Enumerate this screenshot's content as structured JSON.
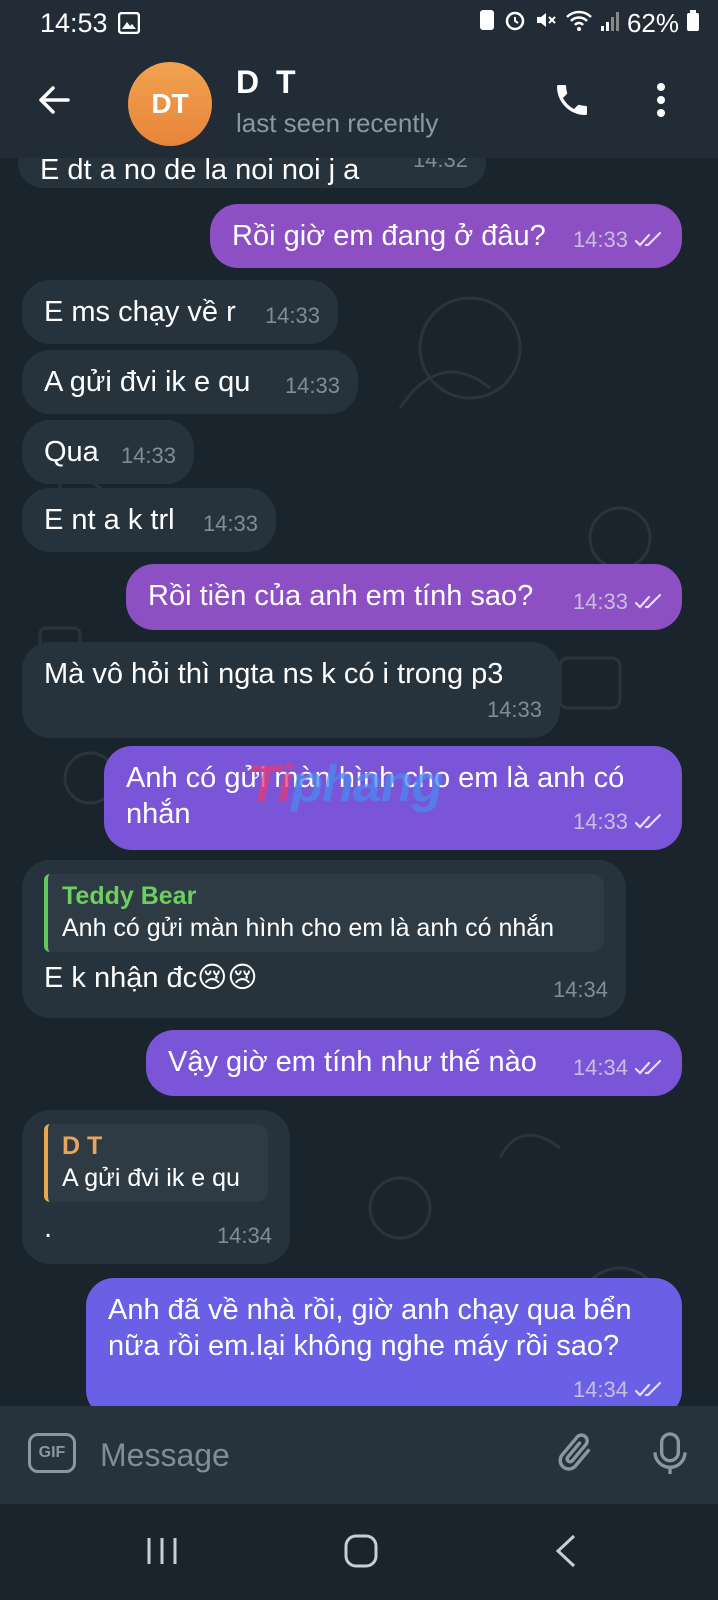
{
  "status_bar": {
    "time": "14:53",
    "battery": "62%"
  },
  "header": {
    "avatar_initials": "DT",
    "name": "D T",
    "status": "last seen recently"
  },
  "messages": [
    {
      "dir": "in",
      "text": "E dt a no de la noi noi j a",
      "time": "14:32"
    },
    {
      "dir": "out",
      "text": "Rồi giờ em đang ở đâu?",
      "time": "14:33"
    },
    {
      "dir": "in",
      "text": "E ms chạy về r",
      "time": "14:33"
    },
    {
      "dir": "in",
      "text": "A gửi đvi ik e qu",
      "time": "14:33"
    },
    {
      "dir": "in",
      "text": "Qua",
      "time": "14:33"
    },
    {
      "dir": "in",
      "text": "E nt a k trl",
      "time": "14:33"
    },
    {
      "dir": "out",
      "text": "Rồi tiền của anh em tính sao?",
      "time": "14:33"
    },
    {
      "dir": "in",
      "text": "Mà vô hỏi thì ngta ns k có i trong p3",
      "time": "14:33"
    },
    {
      "dir": "out",
      "text": "Anh có gửi màn hình cho em là anh có nhắn",
      "time": "14:33"
    },
    {
      "dir": "in",
      "reply_name": "Teddy Bear",
      "reply_text": "Anh có gửi màn hình cho em là anh có nhắn",
      "text": "E k nhận đc😢😢",
      "time": "14:34"
    },
    {
      "dir": "out",
      "text": "Vậy giờ em tính như thế nào",
      "time": "14:34"
    },
    {
      "dir": "in",
      "reply_name": "D T",
      "reply_text": "A gửi đvi ik e qu",
      "text": ".",
      "time": "14:34"
    },
    {
      "dir": "out",
      "text": "Anh đã về nhà rồi, giờ anh chạy qua bển nữa rồi em.lại không nghe máy rồi sao?",
      "time": "14:34"
    }
  ],
  "watermark": {
    "part1": "Ti",
    "part2": "phang"
  },
  "input": {
    "gif_label": "GIF",
    "placeholder": "Message"
  },
  "colors": {
    "header_bg": "#222c36",
    "chat_bg": "#1a242c",
    "incoming_bubble": "#26323c",
    "outgoing_bubble": "#8c4fc4",
    "avatar": "#e8843a"
  }
}
